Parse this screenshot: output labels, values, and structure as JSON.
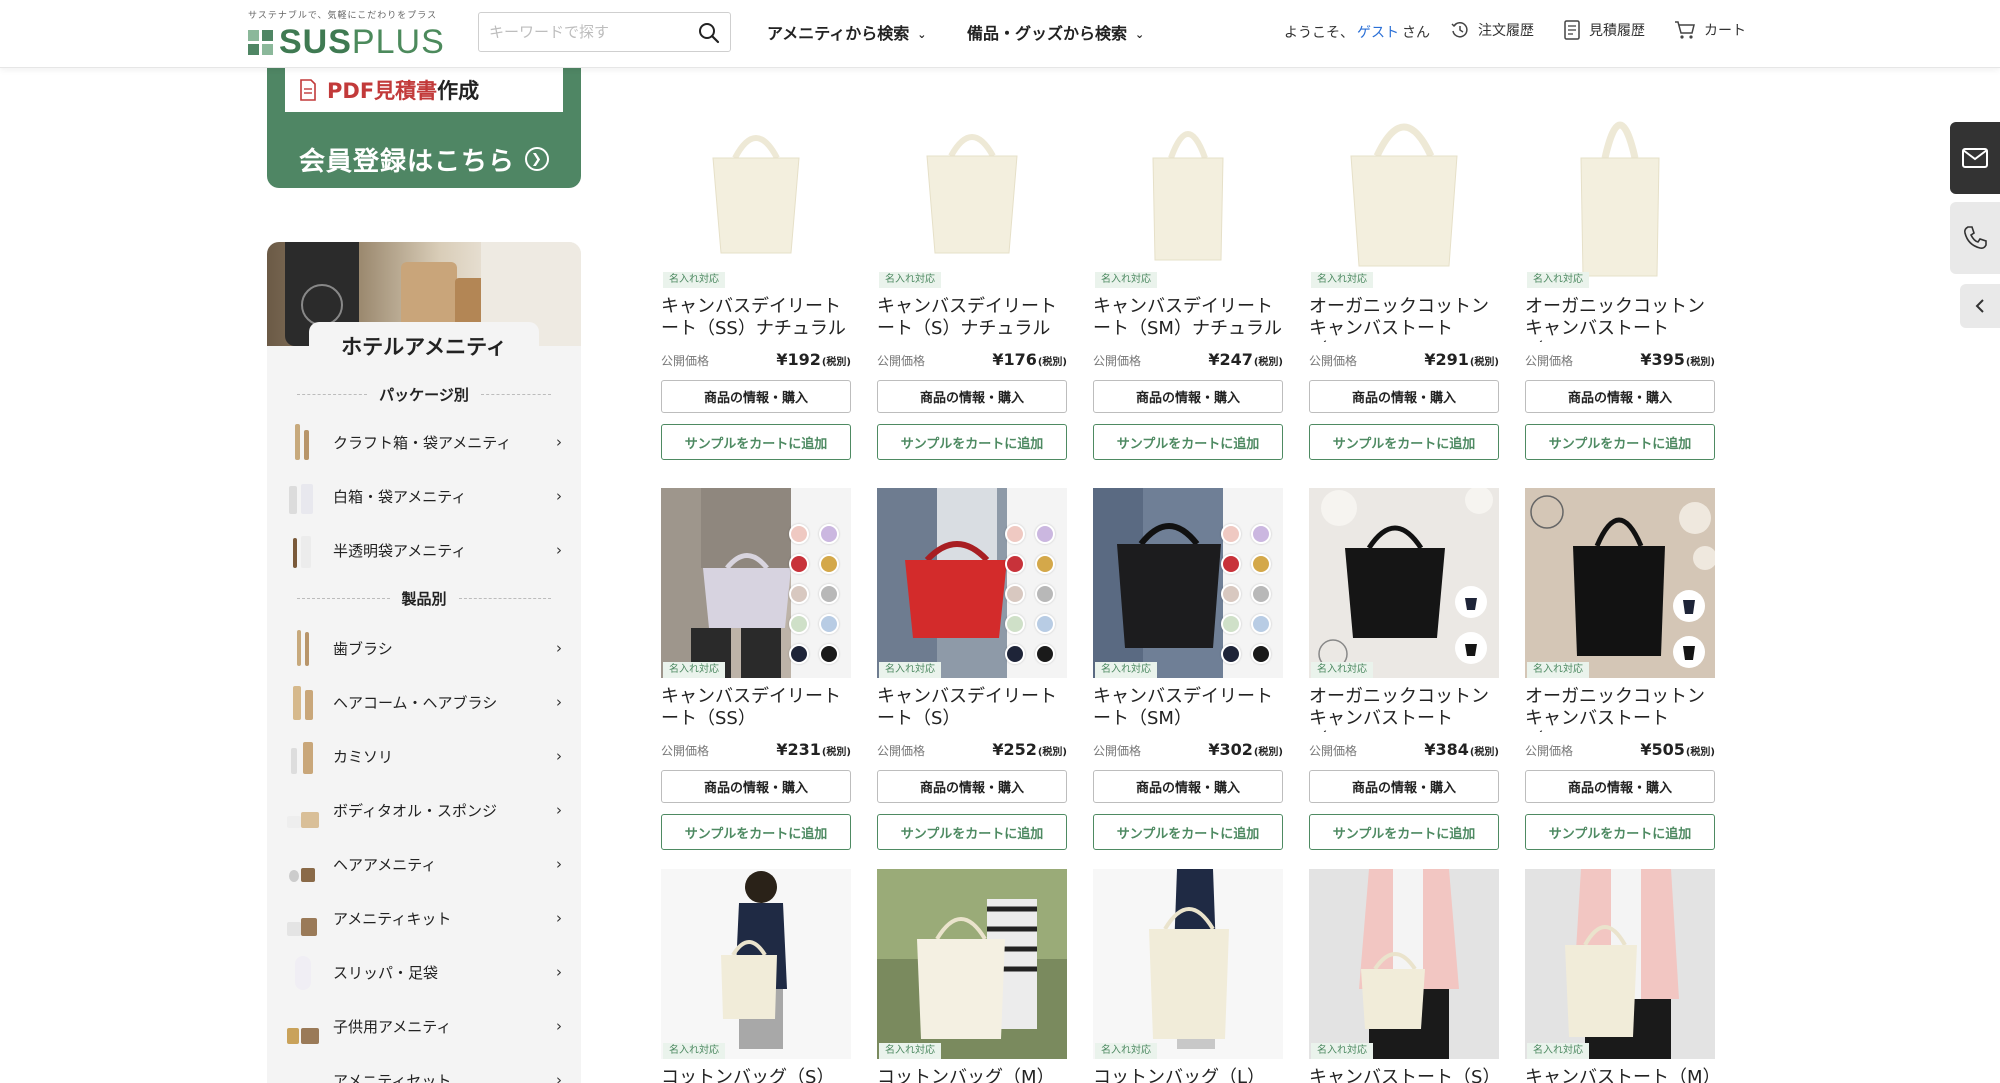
{
  "header": {
    "logo_tagline": "サステナブルで、気軽にこだわりをプラス",
    "logo_sus": "SUS",
    "logo_plus": "PLUS",
    "search_placeholder": "キーワードで探す",
    "nav_amenity": "アメニティから検索",
    "nav_goods": "備品・グッズから検索",
    "welcome_prefix": "ようこそ、",
    "welcome_guest": "ゲスト",
    "welcome_suffix": "さん",
    "order_history": "注文履歴",
    "estimate_history": "見積履歴",
    "cart": "カート"
  },
  "promo": {
    "pdf_bold": "PDF見積書",
    "pdf_rest": "作成",
    "register": "会員登録はこちら"
  },
  "sidebar": {
    "title": "ホテルアメニティ",
    "section_package": "パッケージ別",
    "package_items": [
      {
        "label": "クラフト箱・袋アメニティ"
      },
      {
        "label": "白箱・袋アメニティ"
      },
      {
        "label": "半透明袋アメニティ"
      }
    ],
    "section_product": "製品別",
    "product_items": [
      {
        "label": "歯ブラシ"
      },
      {
        "label": "ヘアコーム・ヘアブラシ"
      },
      {
        "label": "カミソリ"
      },
      {
        "label": "ボディタオル・スポンジ"
      },
      {
        "label": "ヘアアメニティ"
      },
      {
        "label": "アメニティキット"
      },
      {
        "label": "スリッパ・足袋"
      },
      {
        "label": "子供用アメニティ"
      },
      {
        "label": "アメニティセット"
      }
    ]
  },
  "products": {
    "badge": "名入れ対応",
    "price_label": "公開価格",
    "tax_note": "(税別)",
    "info_button": "商品の情報・購入",
    "sample_button": "サンプルをカートに追加",
    "row1": [
      {
        "name": "キャンバスデイリートート（SS）ナチュラル",
        "price": "¥192"
      },
      {
        "name": "キャンバスデイリートート（S）ナチュラル",
        "price": "¥176"
      },
      {
        "name": "キャンバスデイリートート（SM）ナチュラル",
        "price": "¥247"
      },
      {
        "name": "オーガニックコットンキャンバストート（S...",
        "price": "¥291"
      },
      {
        "name": "オーガニックコットンキャンバストート（M...",
        "price": "¥395"
      }
    ],
    "row2": [
      {
        "name": "キャンバスデイリートート（SS）",
        "price": "¥231"
      },
      {
        "name": "キャンバスデイリートート（S）",
        "price": "¥252"
      },
      {
        "name": "キャンバスデイリートート（SM）",
        "price": "¥302"
      },
      {
        "name": "オーガニックコットンキャンバストート（S...",
        "price": "¥384"
      },
      {
        "name": "オーガニックコットンキャンバストート（M...",
        "price": "¥505"
      }
    ],
    "row3": [
      {
        "name": "コットンバッグ（S）"
      },
      {
        "name": "コットンバッグ（M）"
      },
      {
        "name": "コットンバッグ（L）"
      },
      {
        "name": "キャンバストート（S）"
      },
      {
        "name": "キャンバストート（M）"
      }
    ]
  },
  "colors": {
    "brand_green": "#4f8664",
    "accent_green": "#4e8a62",
    "guest_blue": "#2a6fd6",
    "pdf_red": "#c23a3a"
  }
}
